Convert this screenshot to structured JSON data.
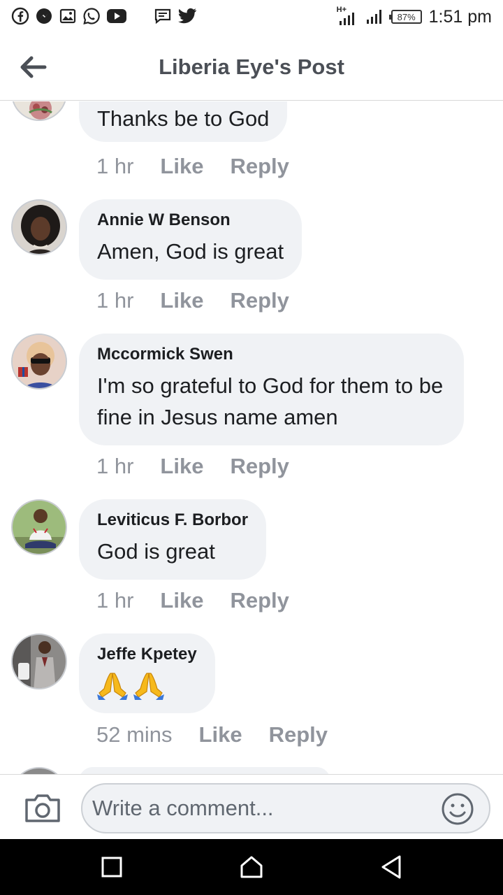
{
  "status_bar": {
    "left_icons": [
      "facebook-icon",
      "messenger-icon",
      "gallery-icon",
      "whatsapp-icon",
      "youtube-icon",
      "message-icon",
      "twitter-icon"
    ],
    "network": "H+",
    "battery": "87%",
    "time": "1:51 pm"
  },
  "header": {
    "title": "Liberia Eye's Post"
  },
  "comments": [
    {
      "author": "",
      "text": "Thanks be to God",
      "time": "1 hr",
      "like": "Like",
      "reply": "Reply"
    },
    {
      "author": "Annie W Benson",
      "text": "Amen, God is great",
      "time": "1 hr",
      "like": "Like",
      "reply": "Reply"
    },
    {
      "author": "Mccormick Swen",
      "text": "I'm so grateful to God for them to be fine in Jesus name amen",
      "time": "1 hr",
      "like": "Like",
      "reply": "Reply"
    },
    {
      "author": "Leviticus F. Borbor",
      "text": "God is great",
      "time": "1 hr",
      "like": "Like",
      "reply": "Reply"
    },
    {
      "author": "Jeffe Kpetey",
      "text": "🙏🙏",
      "time": "52 mins",
      "like": "Like",
      "reply": "Reply"
    }
  ],
  "composer": {
    "placeholder": "Write a comment..."
  },
  "colors": {
    "bubble": "#f0f2f5",
    "meta_text": "#90949c",
    "title_text": "#4b4f56"
  }
}
